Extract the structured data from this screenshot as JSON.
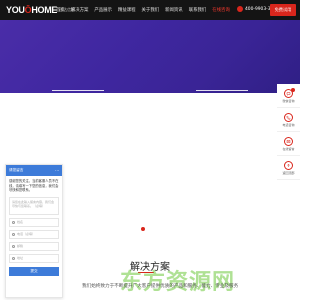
{
  "header": {
    "logo_main": "YOU",
    "logo_o": "Ō",
    "logo_tail": "HOME",
    "logo_sub": "创达信息",
    "nav": [
      "首页",
      "解决方案",
      "产品展示",
      "精益课程",
      "关于我们",
      "新闻资讯",
      "联系我们",
      "在线咨询"
    ],
    "phone": "400-9903-315",
    "cta": "免费试用"
  },
  "sidebar": {
    "items": [
      {
        "label": "微信咨询",
        "icon": "chat-icon"
      },
      {
        "label": "电话咨询",
        "icon": "phone-icon"
      },
      {
        "label": "在线留言",
        "icon": "message-icon"
      },
      {
        "label": "返回顶部",
        "icon": "arrow-up-icon"
      }
    ]
  },
  "chat": {
    "title": "请您留言",
    "dots": "···",
    "message": "感谢您的关注，当前客服人员不在线，请填写一下您的信息，我们会尽快和您联系。",
    "textarea_placeholder": "请您在此输入留言内容，我们会尽快与您联系。（必填）",
    "fields": [
      "姓名",
      "电话（必填）",
      "邮箱",
      "地址"
    ],
    "submit": "提交"
  },
  "section": {
    "title": "解决方案",
    "description": "我们始终致力于不断提升广大客户提供优质的产品和服务、能力、专业及服务"
  },
  "watermark": "东方资源网"
}
